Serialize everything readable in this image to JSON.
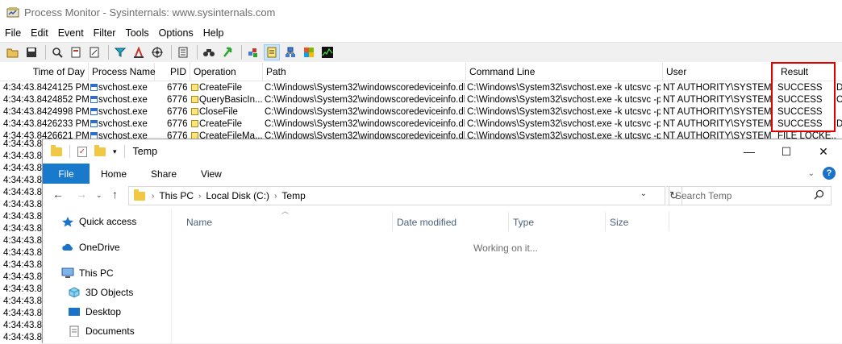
{
  "procmon": {
    "title": "Process Monitor - Sysinternals: www.sysinternals.com",
    "menu": [
      "File",
      "Edit",
      "Event",
      "Filter",
      "Tools",
      "Options",
      "Help"
    ],
    "columns": [
      "Time of Day",
      "Process Name",
      "PID",
      "Operation",
      "Path",
      "Command Line",
      "User",
      "Result"
    ],
    "rows": [
      {
        "time": "4:34:43.8424125 PM",
        "process": "svchost.exe",
        "pid": "6776",
        "operation": "CreateFile",
        "path": "C:\\Windows\\System32\\windowscoredeviceinfo.dll",
        "cmd": "C:\\Windows\\System32\\svchost.exe -k utcsvc -p",
        "user": "NT AUTHORITY\\SYSTEM",
        "result": "SUCCESS",
        "extra": "D"
      },
      {
        "time": "4:34:43.8424852 PM",
        "process": "svchost.exe",
        "pid": "6776",
        "operation": "QueryBasicIn...",
        "path": "C:\\Windows\\System32\\windowscoredeviceinfo.dll",
        "cmd": "C:\\Windows\\System32\\svchost.exe -k utcsvc -p",
        "user": "NT AUTHORITY\\SYSTEM",
        "result": "SUCCESS",
        "extra": "C"
      },
      {
        "time": "4:34:43.8424998 PM",
        "process": "svchost.exe",
        "pid": "6776",
        "operation": "CloseFile",
        "path": "C:\\Windows\\System32\\windowscoredeviceinfo.dll",
        "cmd": "C:\\Windows\\System32\\svchost.exe -k utcsvc -p",
        "user": "NT AUTHORITY\\SYSTEM",
        "result": "SUCCESS",
        "extra": ""
      },
      {
        "time": "4:34:43.8426233 PM",
        "process": "svchost.exe",
        "pid": "6776",
        "operation": "CreateFile",
        "path": "C:\\Windows\\System32\\windowscoredeviceinfo.dll",
        "cmd": "C:\\Windows\\System32\\svchost.exe -k utcsvc -p",
        "user": "NT AUTHORITY\\SYSTEM",
        "result": "SUCCESS",
        "extra": "D"
      },
      {
        "time": "4:34:43.8426621 PM",
        "process": "svchost.exe",
        "pid": "6776",
        "operation": "CreateFileMa...",
        "path": "C:\\Windows\\System32\\windowscoredeviceinfo.dll",
        "cmd": "C:\\Windows\\System32\\svchost.exe -k utcsvc -p",
        "user": "NT AUTHORITY\\SYSTEM",
        "result": "FILE LOCKE...",
        "extra": ""
      }
    ],
    "partial_time": "4:34:43.8",
    "partial_rows": [
      "4:34:43.8",
      "4:34:43.8",
      "4:34:43.8",
      "4:34:43.8",
      "4:34:43.8",
      "4:34:43.8",
      "4:34:43.8",
      "4:34:43.8",
      "4:34:43.8",
      "4:34:43.8",
      "4:34:43.8",
      "4:34:43.8",
      "4:34:43.8",
      "4:34:43.8",
      "4:34:43.8",
      "4:34:43.8",
      "4:34:43.8"
    ],
    "highlight_color": "#e00000"
  },
  "explorer": {
    "title": "Temp",
    "ribbon_tabs": [
      "File",
      "Home",
      "Share",
      "View"
    ],
    "breadcrumb": [
      "This PC",
      "Local Disk (C:)",
      "Temp"
    ],
    "search_placeholder": "Search Temp",
    "columns": [
      "Name",
      "Date modified",
      "Type",
      "Size"
    ],
    "status_message": "Working on it...",
    "nav": {
      "quick_access": "Quick access",
      "onedrive": "OneDrive",
      "this_pc": "This PC",
      "objects3d": "3D Objects",
      "desktop": "Desktop",
      "documents": "Documents"
    },
    "accent": "#1979ca"
  }
}
